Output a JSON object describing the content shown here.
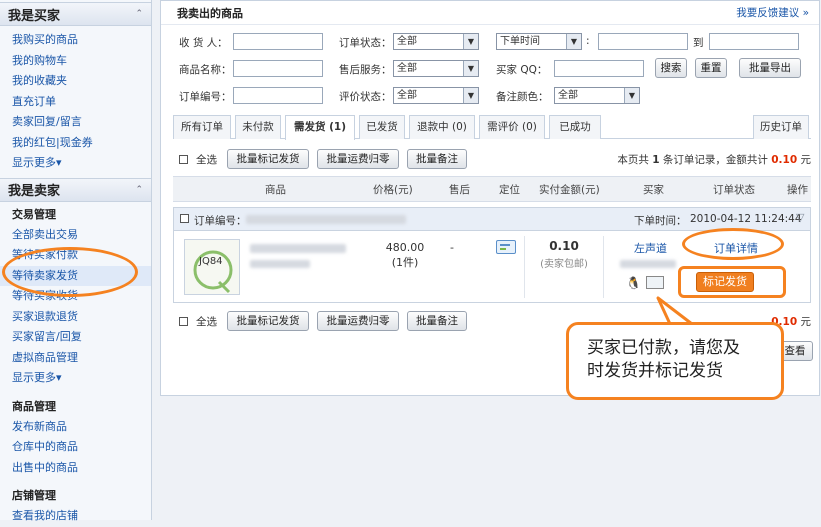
{
  "sidebar": {
    "buyer": {
      "title": "我是买家",
      "items": [
        "我购买的商品",
        "我的购物车",
        "我的收藏夹",
        "直充订单",
        "卖家回复/留言",
        "我的红包|现金券"
      ],
      "more": "显示更多▾"
    },
    "seller": {
      "title": "我是卖家",
      "group1_title": "交易管理",
      "group1_items": [
        "全部卖出交易",
        "等待买家付款",
        "等待卖家发货",
        "等待买家收货",
        "买家退款退货",
        "买家留言/回复",
        "虚拟商品管理"
      ],
      "more": "显示更多▾",
      "group2_title": "商品管理",
      "group2_items": [
        "发布新商品",
        "仓库中的商品",
        "出售中的商品"
      ],
      "group3_title": "店铺管理",
      "group3_items": [
        "查看我的店铺"
      ]
    }
  },
  "main": {
    "title": "我卖出的商品",
    "feedback_link": "我要反馈建议 »",
    "form": {
      "receiver_label": "收 货 人：",
      "order_status_label": "订单状态：",
      "order_status_value": "全部",
      "time_select_value": "下单时间",
      "to_label": "到",
      "product_name_label": "商品名称：",
      "after_sale_label": "售后服务：",
      "after_sale_value": "全部",
      "buyer_qq_label": "买家 QQ：",
      "order_id_label": "订单编号：",
      "rating_status_label": "评价状态：",
      "rating_status_value": "全部",
      "note_color_label": "备注颜色：",
      "note_color_value": "全部",
      "search_button": "搜索",
      "reset_button": "重置",
      "export_button": "批量导出"
    },
    "tabs": [
      "所有订单",
      "未付款",
      "需发货 (1)",
      "已发货",
      "退款中 (0)",
      "需评价 (0)",
      "已成功"
    ],
    "history_tab": "历史订单",
    "bulk_bar": {
      "select_all": "全选",
      "mark_shipped": "批量标记发货",
      "shipping_fee": "批量运费归零",
      "bulk_note": "批量备注",
      "summary_prefix": "本页共 ",
      "summary_count": "1",
      "summary_mid": " 条订单记录，金额共计 ",
      "summary_amount": "0.10",
      "summary_suffix": " 元"
    },
    "table_headers": {
      "product": "商品",
      "price": "价格(元)",
      "after_sale": "售后",
      "position": "定位",
      "paid_amount": "实付金额(元)",
      "buyer": "买家",
      "order_status": "订单状态",
      "action": "操作"
    },
    "order": {
      "order_id_label": "订单编号：",
      "order_time_label": "下单时间：",
      "order_time": "2010-04-12 11:24:44",
      "price": "480.00",
      "qty": "(1件)",
      "after_sale": "-",
      "paid": "0.10",
      "paid_note": "(卖家包邮)",
      "buyer_name": "左声道",
      "detail_link": "订单详情",
      "mark_shipped_button": "标记发货"
    },
    "bottom_bar": {
      "select_all": "全选",
      "mark_shipped": "批量标记发货",
      "shipping_fee": "批量运费归零",
      "bulk_note": "批量备注",
      "amount_tail": "0.10",
      "unit": "元",
      "view_button": "查看"
    }
  },
  "callout": {
    "line1": "买家已付款，请您及",
    "line2": "时发货并标记发货"
  },
  "colors": {
    "accent": "#f58220",
    "link": "#1a56a8",
    "price_red": "#e02b00"
  }
}
